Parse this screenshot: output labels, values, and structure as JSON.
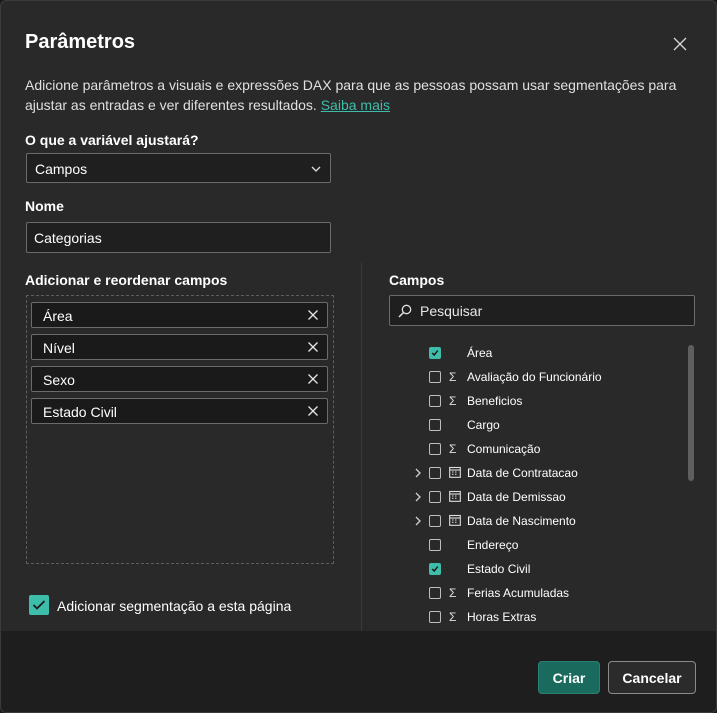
{
  "dialog": {
    "title": "Parâmetros",
    "description": "Adicione parâmetros a visuais e expressões DAX para que as pessoas possam usar segmentações para ajustar as entradas e ver diferentes resultados.",
    "learn_more": "Saiba mais"
  },
  "variable": {
    "label": "O que a variável ajustará?",
    "selected": "Campos"
  },
  "name": {
    "label": "Nome",
    "value": "Categorias"
  },
  "reorder": {
    "label": "Adicionar e reordenar campos",
    "items": [
      {
        "label": "Área"
      },
      {
        "label": "Nível"
      },
      {
        "label": "Sexo"
      },
      {
        "label": "Estado Civil"
      }
    ]
  },
  "fields": {
    "label": "Campos",
    "search_placeholder": "Pesquisar",
    "list": [
      {
        "name": "Área",
        "checked": true,
        "icon": "none",
        "expandable": false
      },
      {
        "name": "Avaliação do Funcionário",
        "checked": false,
        "icon": "sigma",
        "expandable": false
      },
      {
        "name": "Beneficios",
        "checked": false,
        "icon": "sigma",
        "expandable": false
      },
      {
        "name": "Cargo",
        "checked": false,
        "icon": "none",
        "expandable": false
      },
      {
        "name": "Comunicação",
        "checked": false,
        "icon": "sigma",
        "expandable": false
      },
      {
        "name": "Data de Contratacao",
        "checked": false,
        "icon": "calendar",
        "expandable": true
      },
      {
        "name": "Data de Demissao",
        "checked": false,
        "icon": "calendar",
        "expandable": true
      },
      {
        "name": "Data de Nascimento",
        "checked": false,
        "icon": "calendar",
        "expandable": true
      },
      {
        "name": "Endereço",
        "checked": false,
        "icon": "none",
        "expandable": false
      },
      {
        "name": "Estado Civil",
        "checked": true,
        "icon": "none",
        "expandable": false
      },
      {
        "name": "Ferias Acumuladas",
        "checked": false,
        "icon": "sigma",
        "expandable": false
      },
      {
        "name": "Horas Extras",
        "checked": false,
        "icon": "sigma",
        "expandable": false
      }
    ]
  },
  "slicer": {
    "label": "Adicionar segmentação a esta página",
    "checked": true
  },
  "buttons": {
    "create": "Criar",
    "cancel": "Cancelar"
  },
  "colors": {
    "accent": "#3fbdab",
    "primary_button": "#1a6b5e"
  }
}
